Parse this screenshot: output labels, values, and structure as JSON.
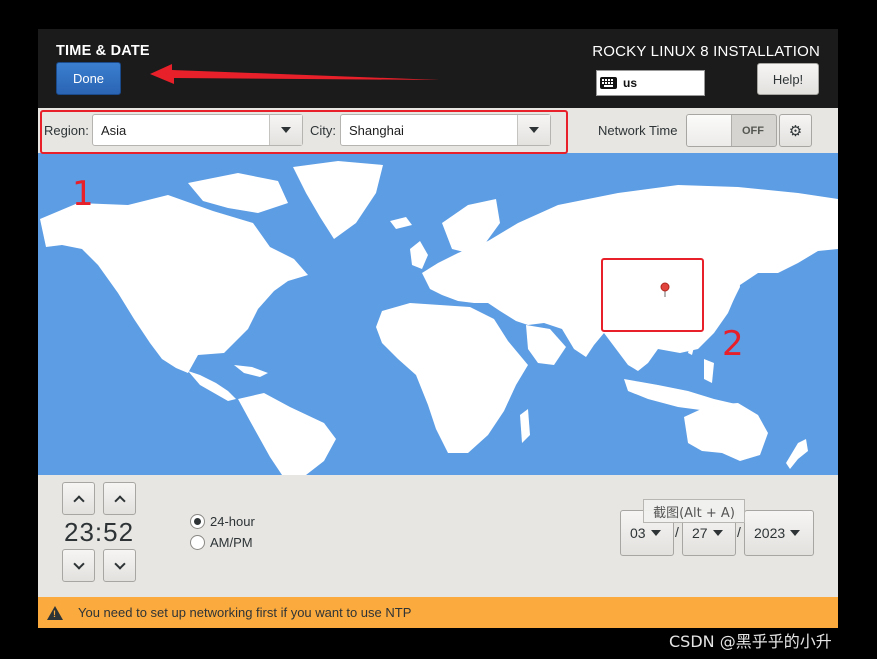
{
  "header": {
    "page_title": "TIME & DATE",
    "done_label": "Done",
    "install_title": "ROCKY LINUX 8 INSTALLATION",
    "keyboard_layout": "us",
    "help_label": "Help!"
  },
  "toolbar": {
    "region_label": "Region:",
    "region_value": "Asia",
    "city_label": "City:",
    "city_value": "Shanghai",
    "network_time_label": "Network Time",
    "network_time_state": "OFF",
    "gear_icon": "gear-icon"
  },
  "map": {
    "ocean_color": "#5c9de4",
    "land_color": "#ffffff",
    "marker_color": "#e0443c"
  },
  "time": {
    "value": "23:52",
    "format_24h_label": "24-hour",
    "format_ampm_label": "AM/PM",
    "selected_format": "24-hour"
  },
  "date": {
    "month": "03",
    "day": "27",
    "year": "2023",
    "separator": "/"
  },
  "tooltip": {
    "text": "截图(Alt + A)"
  },
  "warning": {
    "text": "You need to set up networking first if you want to use NTP",
    "color": "#fbaa3e"
  },
  "annotations": {
    "label_1": "1",
    "label_2": "2",
    "color": "#e8202a"
  },
  "watermark": "CSDN @黑乎乎的小升"
}
